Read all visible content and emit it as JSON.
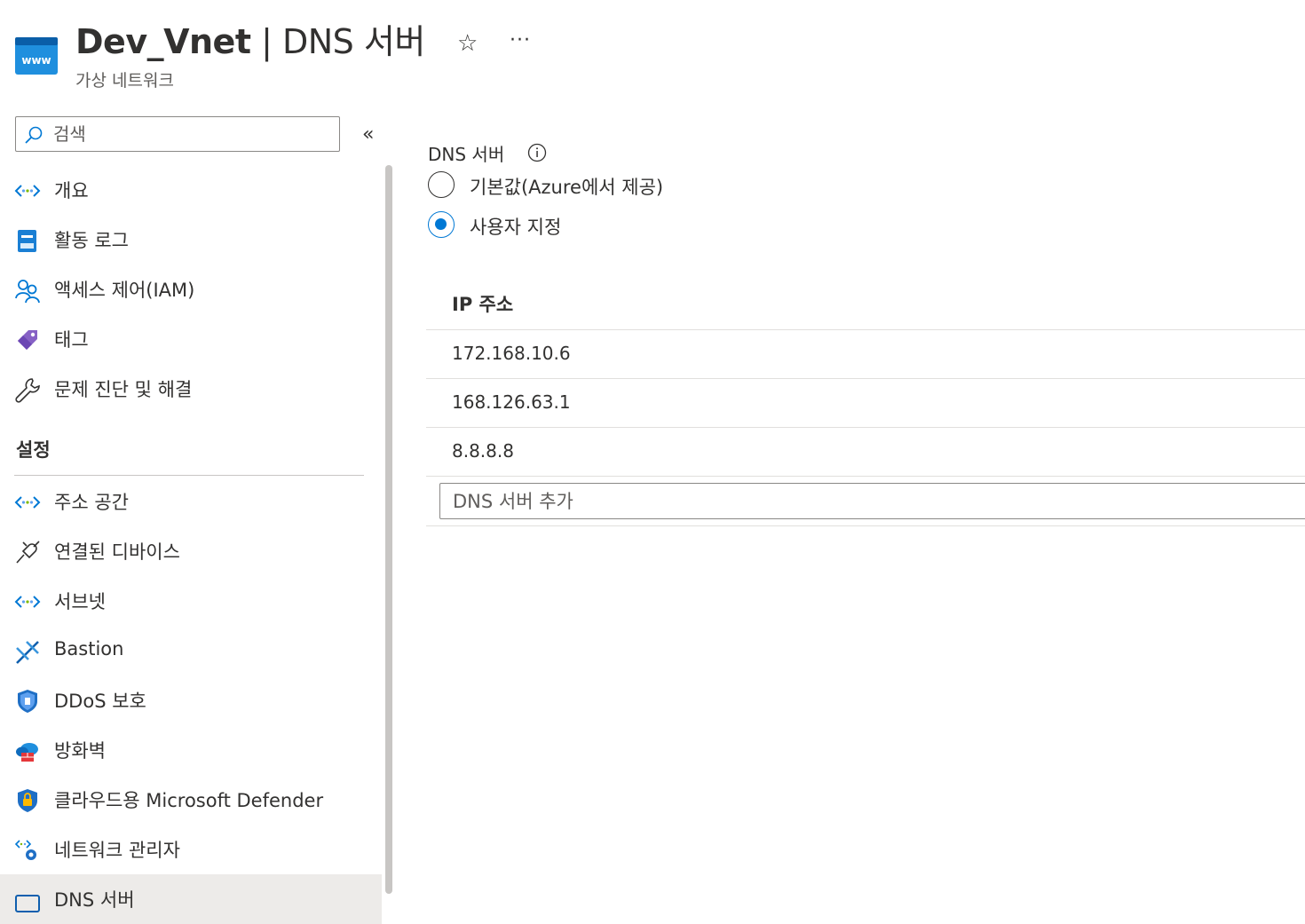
{
  "header": {
    "resource_name": "Dev_Vnet",
    "separator": " | ",
    "page_name": "DNS 서버",
    "subtitle": "가상 네트워크",
    "icon_text": "www",
    "star_glyph": "☆",
    "more_glyph": "···"
  },
  "search": {
    "placeholder": "검색",
    "collapse_glyph": "«"
  },
  "nav": {
    "items": [
      {
        "label": "개요",
        "icon": "vnet-icon"
      },
      {
        "label": "활동 로그",
        "icon": "activity-log-icon"
      },
      {
        "label": "액세스 제어(IAM)",
        "icon": "people-icon"
      },
      {
        "label": "태그",
        "icon": "tag-icon"
      },
      {
        "label": "문제 진단 및 해결",
        "icon": "wrench-icon"
      }
    ],
    "section_settings": "설정",
    "settings_items": [
      {
        "label": "주소 공간",
        "icon": "vnet-icon"
      },
      {
        "label": "연결된 디바이스",
        "icon": "plug-icon"
      },
      {
        "label": "서브넷",
        "icon": "vnet-icon"
      },
      {
        "label": "Bastion",
        "icon": "bastion-icon"
      },
      {
        "label": "DDoS 보호",
        "icon": "shield-icon"
      },
      {
        "label": "방화벽",
        "icon": "firewall-icon"
      },
      {
        "label": "클라우드용 Microsoft Defender",
        "icon": "defender-icon"
      },
      {
        "label": "네트워크 관리자",
        "icon": "network-manager-icon"
      },
      {
        "label": "DNS 서버",
        "icon": "dns-icon"
      }
    ]
  },
  "dns": {
    "label": "DNS 서버",
    "options": [
      {
        "label": "기본값(Azure에서 제공)",
        "checked": false
      },
      {
        "label": "사용자 지정",
        "checked": true
      }
    ],
    "column_header": "IP 주소",
    "addresses": [
      "172.168.10.6",
      "168.126.63.1",
      "8.8.8.8"
    ],
    "add_placeholder": "DNS 서버 추가"
  },
  "colors": {
    "accent": "#0078d4",
    "text": "#323130",
    "muted": "#605e5c",
    "selected_bg": "#edebe9"
  }
}
